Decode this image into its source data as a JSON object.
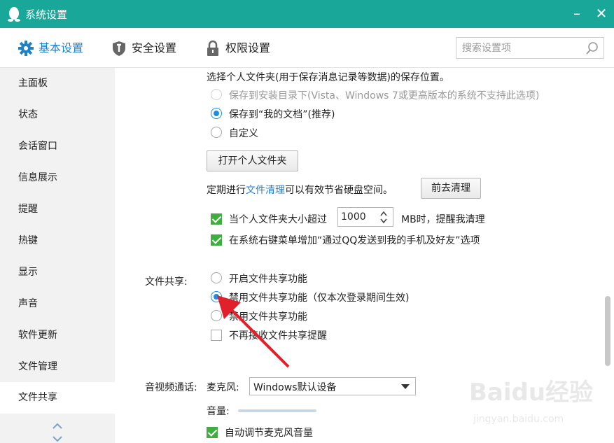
{
  "window": {
    "title": "系统设置",
    "minimize": "–",
    "close": "✕"
  },
  "tabs": [
    {
      "label": "基本设置",
      "icon": "gear-icon",
      "active": true
    },
    {
      "label": "安全设置",
      "icon": "shield-icon"
    },
    {
      "label": "权限设置",
      "icon": "lock-icon"
    }
  ],
  "search": {
    "placeholder": "搜索设置项",
    "value": ""
  },
  "sidebar": {
    "items": [
      {
        "label": "主面板"
      },
      {
        "label": "状态"
      },
      {
        "label": "会话窗口"
      },
      {
        "label": "信息展示"
      },
      {
        "label": "提醒"
      },
      {
        "label": "热键"
      },
      {
        "label": "显示"
      },
      {
        "label": "声音"
      },
      {
        "label": "软件更新"
      },
      {
        "label": "文件管理"
      },
      {
        "label": "文件共享",
        "active": true
      }
    ]
  },
  "file_location": {
    "description": "选择个人文件夹(用于保存消息记录等数据)的保存位置。",
    "options": [
      {
        "label": "保存到安装目录下(Vista、Windows 7或更高版本的系统不支持此选项)",
        "disabled": true,
        "selected": false
      },
      {
        "label": "保存到“我的文档”(推荐)",
        "selected": true
      },
      {
        "label": "自定义",
        "selected": false
      }
    ],
    "open_button": "打开个人文件夹"
  },
  "cleanup": {
    "text_before": "定期进行",
    "link": "文件清理",
    "text_after": "可以有效节省硬盘空间。",
    "button": "前去清理",
    "size_check_label": "当个人文件夹大小超过",
    "size_value": "1000",
    "size_unit_label": "MB时，提醒我清理",
    "size_checked": true,
    "context_menu_label": "在系统右键菜单增加“通过QQ发送到我的手机及好友”选项",
    "context_menu_checked": true
  },
  "file_sharing": {
    "section_label": "文件共享:",
    "options": [
      {
        "label": "开启文件共享功能",
        "selected": false
      },
      {
        "label": "禁用文件共享功能（仅本次登录期间生效)",
        "selected": true
      },
      {
        "label": "禁用文件共享功能",
        "selected": false
      }
    ],
    "no_reminder_label": "不再接收文件共享提醒",
    "no_reminder_checked": false
  },
  "av_call": {
    "section_label": "音视频通话:",
    "mic_label": "麦克风:",
    "mic_device": "Windows默认设备",
    "volume_label": "音量:",
    "auto_adjust_label": "自动调节麦克风音量",
    "auto_adjust_checked": true
  },
  "watermark": {
    "brand": "Baidu经验",
    "url": "jingyan.baidu.com"
  },
  "colors": {
    "titlebar": "#19a79a",
    "accent": "#1f82c6",
    "radio": "#1b8fe0",
    "check": "#3fae3f",
    "arrow": "#e0202a"
  }
}
